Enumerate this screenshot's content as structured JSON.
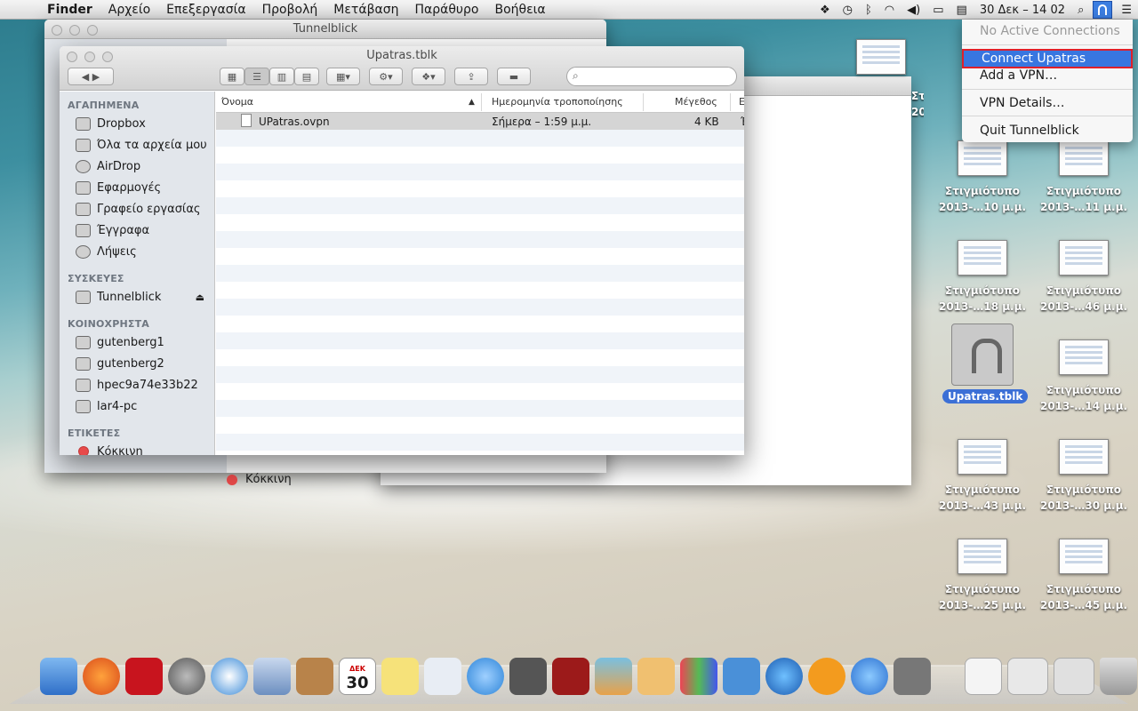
{
  "menubar": {
    "app": "Finder",
    "menus": [
      "Αρχείο",
      "Επεξεργασία",
      "Προβολή",
      "Μετάβαση",
      "Παράθυρο",
      "Βοήθεια"
    ],
    "clock": "30 Δεκ –  14 02"
  },
  "tunnelblick_menu": {
    "status": "No Active Connections",
    "connect": "Connect Upatras",
    "add_vpn": "Add a VPN…",
    "details": "VPN Details…",
    "quit": "Quit Tunnelblick"
  },
  "back_window": {
    "title": "Tunnelblick",
    "sidebar_peek": "Κόκκινη"
  },
  "finder": {
    "title": "Upatras.tblk",
    "sidebar": {
      "favorites_header": "ΑΓΑΠΗΜΕΝΑ",
      "favorites": [
        "Dropbox",
        "Όλα τα αρχεία μου",
        "AirDrop",
        "Εφαρμογές",
        "Γραφείο εργασίας",
        "Έγγραφα",
        "Λήψεις"
      ],
      "devices_header": "ΣΥΣΚΕΥΕΣ",
      "devices": [
        "Tunnelblick"
      ],
      "shared_header": "ΚΟΙΝΟΧΡΗΣΤΑ",
      "shared": [
        "gutenberg1",
        "gutenberg2",
        "hpec9a74e33b22",
        "lar4-pc"
      ],
      "tags_header": "ΕΤΙΚΕΤΕΣ",
      "tags": [
        "Κόκκινη"
      ]
    },
    "columns": {
      "name": "Όνομα",
      "date": "Ημερομηνία τροποποίησης",
      "size": "Μέγεθος",
      "kind": "Ε"
    },
    "files": [
      {
        "name": "UPatras.ovpn",
        "date": "Σήμερα – 1:59 μ.μ.",
        "size": "4 KB",
        "kind": "Έ"
      }
    ]
  },
  "desktop": {
    "selected_item": "Upatras.tblk",
    "screenshots": [
      {
        "line1": "Στιγμιότυπο",
        "line2": "2013-…10 μ.μ."
      },
      {
        "line1": "Στιγμιότυπο",
        "line2": "2013-…11 μ.μ."
      },
      {
        "line1": "Στιγμιότυπο",
        "line2": "2013-…18 μ.μ."
      },
      {
        "line1": "Στιγμιότυπο",
        "line2": "2013-…46 μ.μ."
      },
      {
        "line1": "Στιγμιότυπο",
        "line2": "2013-…14 μ.μ."
      },
      {
        "line1": "Στιγμιότυπο",
        "line2": "2013-…43 μ.μ."
      },
      {
        "line1": "Στιγμιότυπο",
        "line2": "2013-…30 μ.μ."
      },
      {
        "line1": "Στιγμιότυπο",
        "line2": "2013-…25 μ.μ."
      },
      {
        "line1": "Στιγμιότυπο",
        "line2": "2013-…45 μ.μ."
      }
    ],
    "partial_labels": [
      "Στ",
      "20"
    ]
  },
  "dock": {
    "calendar_day": "30",
    "calendar_month": "ΔΕΚ"
  },
  "colors": {
    "selection": "#3876e0",
    "highlight_border": "#e0202a"
  }
}
